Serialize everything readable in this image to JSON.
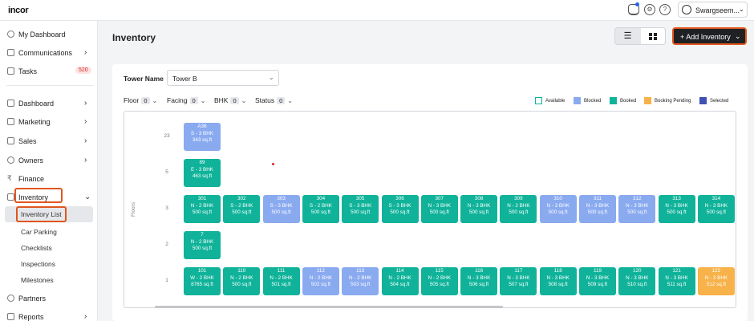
{
  "app": {
    "logo": "incor"
  },
  "header": {
    "user_name": "Swargseem..."
  },
  "colors": {
    "available": "#ffffff",
    "blocked": "#8aaaf0",
    "booked": "#10b39a",
    "booking_pending": "#f7b24a",
    "selected": "#3f51b5",
    "accent_highlight": "#e0561f"
  },
  "sidebar": {
    "items": [
      {
        "label": "My Dashboard",
        "icon": "user-icon"
      },
      {
        "label": "Communications",
        "icon": "chat-icon"
      },
      {
        "label": "Tasks",
        "icon": "calendar-icon",
        "badge": "520"
      },
      {
        "label": "Dashboard",
        "icon": "bar-chart-icon"
      },
      {
        "label": "Marketing",
        "icon": "megaphone-icon"
      },
      {
        "label": "Sales",
        "icon": "tag-icon"
      },
      {
        "label": "Owners",
        "icon": "users-icon"
      },
      {
        "label": "Finance",
        "icon": "rupee-icon"
      },
      {
        "label": "Inventory",
        "icon": "building-icon"
      },
      {
        "label": "Partners",
        "icon": "handshake-icon"
      },
      {
        "label": "Reports",
        "icon": "report-icon"
      }
    ],
    "inventory_sub": [
      "Inventory List",
      "Car Parking",
      "Checklists",
      "Inspections",
      "Milestones"
    ]
  },
  "page": {
    "title": "Inventory",
    "add_button": "+ Add Inventory",
    "list_view_icon": "list-icon",
    "grid_view_icon": "grid-icon"
  },
  "filters": {
    "tower_label": "Tower Name",
    "tower_value": "Tower B",
    "items": [
      {
        "label": "Floor",
        "count": "0"
      },
      {
        "label": "Facing",
        "count": "0"
      },
      {
        "label": "BHK",
        "count": "0"
      },
      {
        "label": "Status",
        "count": "0"
      }
    ]
  },
  "legend": [
    {
      "label": "Available",
      "status": "available"
    },
    {
      "label": "Blocked",
      "status": "blocked"
    },
    {
      "label": "Booked",
      "status": "booked"
    },
    {
      "label": "Booking Pending",
      "status": "booking_pending"
    },
    {
      "label": "Selected",
      "status": "selected"
    }
  ],
  "grid": {
    "axis_label": "Floors",
    "floors": [
      {
        "floor": "23",
        "units": [
          {
            "no": "A36",
            "type": "S - 3 BHK",
            "area": "343 sq.ft",
            "status": "blocked"
          }
        ]
      },
      {
        "floor": "5",
        "units": [
          {
            "no": "89",
            "type": "E - 3 BHK",
            "area": "463 sq.ft",
            "status": "booked"
          }
        ]
      },
      {
        "floor": "3",
        "units": [
          {
            "no": "301",
            "type": "N - 2 BHK",
            "area": "500 sq.ft",
            "status": "booked"
          },
          {
            "no": "302",
            "type": "S - 2 BHK",
            "area": "500 sq.ft",
            "status": "booked"
          },
          {
            "no": "303",
            "type": "S - 3 BHK",
            "area": "500 sq.ft",
            "status": "blocked"
          },
          {
            "no": "304",
            "type": "S - 2 BHK",
            "area": "500 sq.ft",
            "status": "booked"
          },
          {
            "no": "305",
            "type": "S - 3 BHK",
            "area": "500 sq.ft",
            "status": "booked"
          },
          {
            "no": "306",
            "type": "S - 3 BHK",
            "area": "500 sq.ft",
            "status": "booked"
          },
          {
            "no": "307",
            "type": "N - 3 BHK",
            "area": "500 sq.ft",
            "status": "booked"
          },
          {
            "no": "308",
            "type": "N - 3 BHK",
            "area": "500 sq.ft",
            "status": "booked"
          },
          {
            "no": "309",
            "type": "N - 2 BHK",
            "area": "500 sq.ft",
            "status": "booked"
          },
          {
            "no": "310",
            "type": "N - 3 BHK",
            "area": "500 sq.ft",
            "status": "blocked"
          },
          {
            "no": "311",
            "type": "N - 3 BHK",
            "area": "500 sq.ft",
            "status": "blocked"
          },
          {
            "no": "312",
            "type": "N - 3 BHK",
            "area": "500 sq.ft",
            "status": "blocked"
          },
          {
            "no": "313",
            "type": "N - 3 BHK",
            "area": "500 sq.ft",
            "status": "booked"
          },
          {
            "no": "314",
            "type": "N - 3 BHK",
            "area": "500 sq.ft",
            "status": "booked"
          }
        ]
      },
      {
        "floor": "2",
        "units": [
          {
            "no": "7",
            "type": "N - 2 BHK",
            "area": "500 sq.ft",
            "status": "booked"
          }
        ]
      },
      {
        "floor": "1",
        "units": [
          {
            "no": "101",
            "type": "W - 2 BHK",
            "area": "8765 sq.ft",
            "status": "booked"
          },
          {
            "no": "110",
            "type": "N - 2 BHK",
            "area": "500 sq.ft",
            "status": "booked"
          },
          {
            "no": "111",
            "type": "N - 2 BHK",
            "area": "501 sq.ft",
            "status": "booked"
          },
          {
            "no": "112",
            "type": "N - 2 BHK",
            "area": "502 sq.ft",
            "status": "blocked"
          },
          {
            "no": "113",
            "type": "N - 2 BHK",
            "area": "503 sq.ft",
            "status": "blocked"
          },
          {
            "no": "114",
            "type": "N - 2 BHK",
            "area": "504 sq.ft",
            "status": "booked"
          },
          {
            "no": "115",
            "type": "N - 2 BHK",
            "area": "505 sq.ft",
            "status": "booked"
          },
          {
            "no": "116",
            "type": "N - 3 BHK",
            "area": "506 sq.ft",
            "status": "booked"
          },
          {
            "no": "117",
            "type": "N - 3 BHK",
            "area": "507 sq.ft",
            "status": "booked"
          },
          {
            "no": "118",
            "type": "N - 3 BHK",
            "area": "508 sq.ft",
            "status": "booked"
          },
          {
            "no": "119",
            "type": "N - 3 BHK",
            "area": "509 sq.ft",
            "status": "booked"
          },
          {
            "no": "120",
            "type": "N - 3 BHK",
            "area": "510 sq.ft",
            "status": "booked"
          },
          {
            "no": "121",
            "type": "N - 3 BHK",
            "area": "511 sq.ft",
            "status": "booked"
          },
          {
            "no": "122",
            "type": "N - 3 BHK",
            "area": "512 sq.ft",
            "status": "booking_pending"
          }
        ]
      }
    ]
  }
}
